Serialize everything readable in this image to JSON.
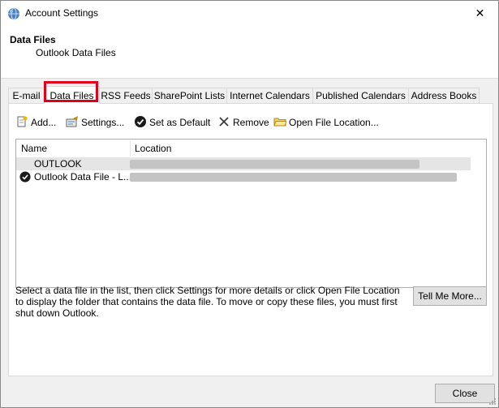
{
  "window": {
    "title": "Account Settings"
  },
  "header": {
    "title": "Data Files",
    "subtitle": "Outlook Data Files"
  },
  "tabs": [
    {
      "label": "E-mail"
    },
    {
      "label": "Data Files"
    },
    {
      "label": "RSS Feeds"
    },
    {
      "label": "SharePoint Lists"
    },
    {
      "label": "Internet Calendars"
    },
    {
      "label": "Published Calendars"
    },
    {
      "label": "Address Books"
    }
  ],
  "toolbar": {
    "add": "Add...",
    "settings": "Settings...",
    "set_default": "Set as Default",
    "remove": "Remove",
    "open_location": "Open File Location..."
  },
  "list": {
    "columns": {
      "name": "Name",
      "location": "Location"
    },
    "rows": [
      {
        "name": "OUTLOOK"
      },
      {
        "name": "Outlook Data File - L..."
      }
    ]
  },
  "help_text": "Select a data file in the list, then click Settings for more details or click Open File Location to display the folder that contains the data file. To move or copy these files, you must first shut down Outlook.",
  "buttons": {
    "tell_me_more": "Tell Me More...",
    "close": "Close"
  },
  "colors": {
    "highlight": "#e0001b"
  }
}
